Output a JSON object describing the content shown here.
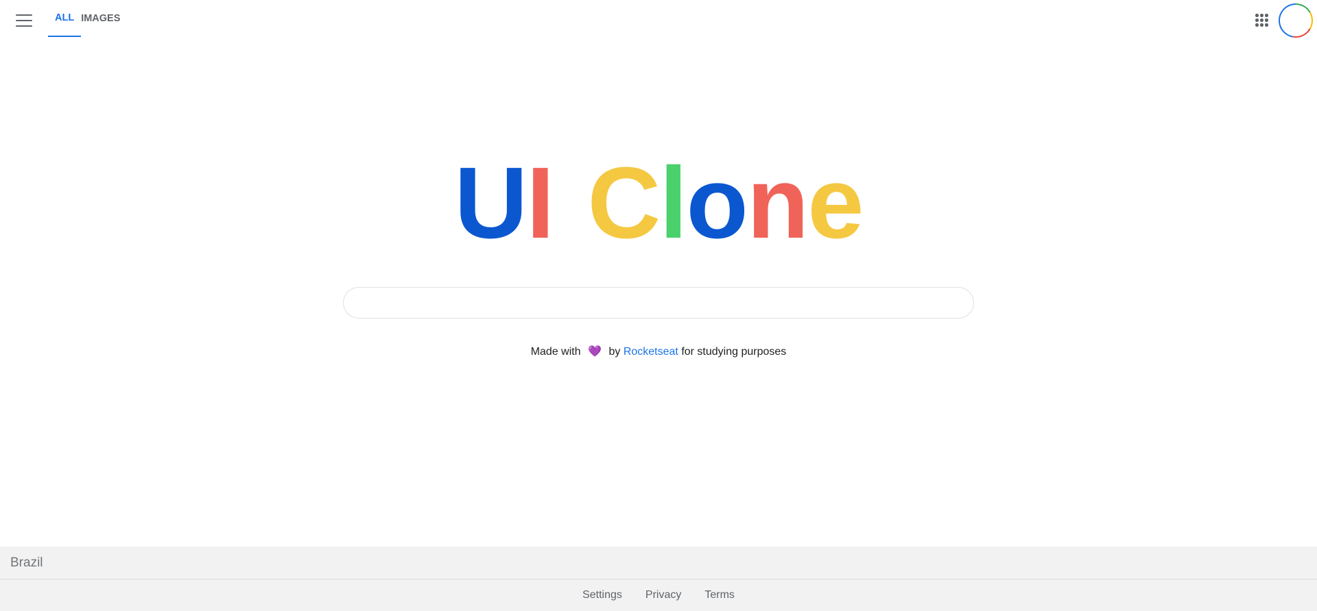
{
  "header": {
    "menu_icon": "hamburger-menu-icon",
    "tabs": [
      {
        "label": "ALL",
        "active": true
      },
      {
        "label": "IMAGES",
        "active": false
      }
    ],
    "apps_icon": "apps-grid-icon",
    "avatar_icon": "avatar-ring",
    "accent_color": "#1a73e8"
  },
  "logo": {
    "letters": [
      {
        "char": "U",
        "color": "#0b57d0"
      },
      {
        "char": "I",
        "color": "#f06358"
      },
      {
        "char": " ",
        "color": "#ffffff"
      },
      {
        "char": "C",
        "color": "#f5c842"
      },
      {
        "char": "l",
        "color": "#4ad16b"
      },
      {
        "char": "o",
        "color": "#0b57d0"
      },
      {
        "char": "n",
        "color": "#f06358"
      },
      {
        "char": "e",
        "color": "#f5c842"
      }
    ]
  },
  "search": {
    "value": "",
    "placeholder": ""
  },
  "credit": {
    "prefix": "Made with",
    "heart_icon": "heart-icon",
    "heart_glyph": "💜",
    "by": "by",
    "link_text": "Rocketseat",
    "suffix": "for studying purposes"
  },
  "footer": {
    "country": "Brazil",
    "links": [
      "Settings",
      "Privacy",
      "Terms"
    ]
  }
}
